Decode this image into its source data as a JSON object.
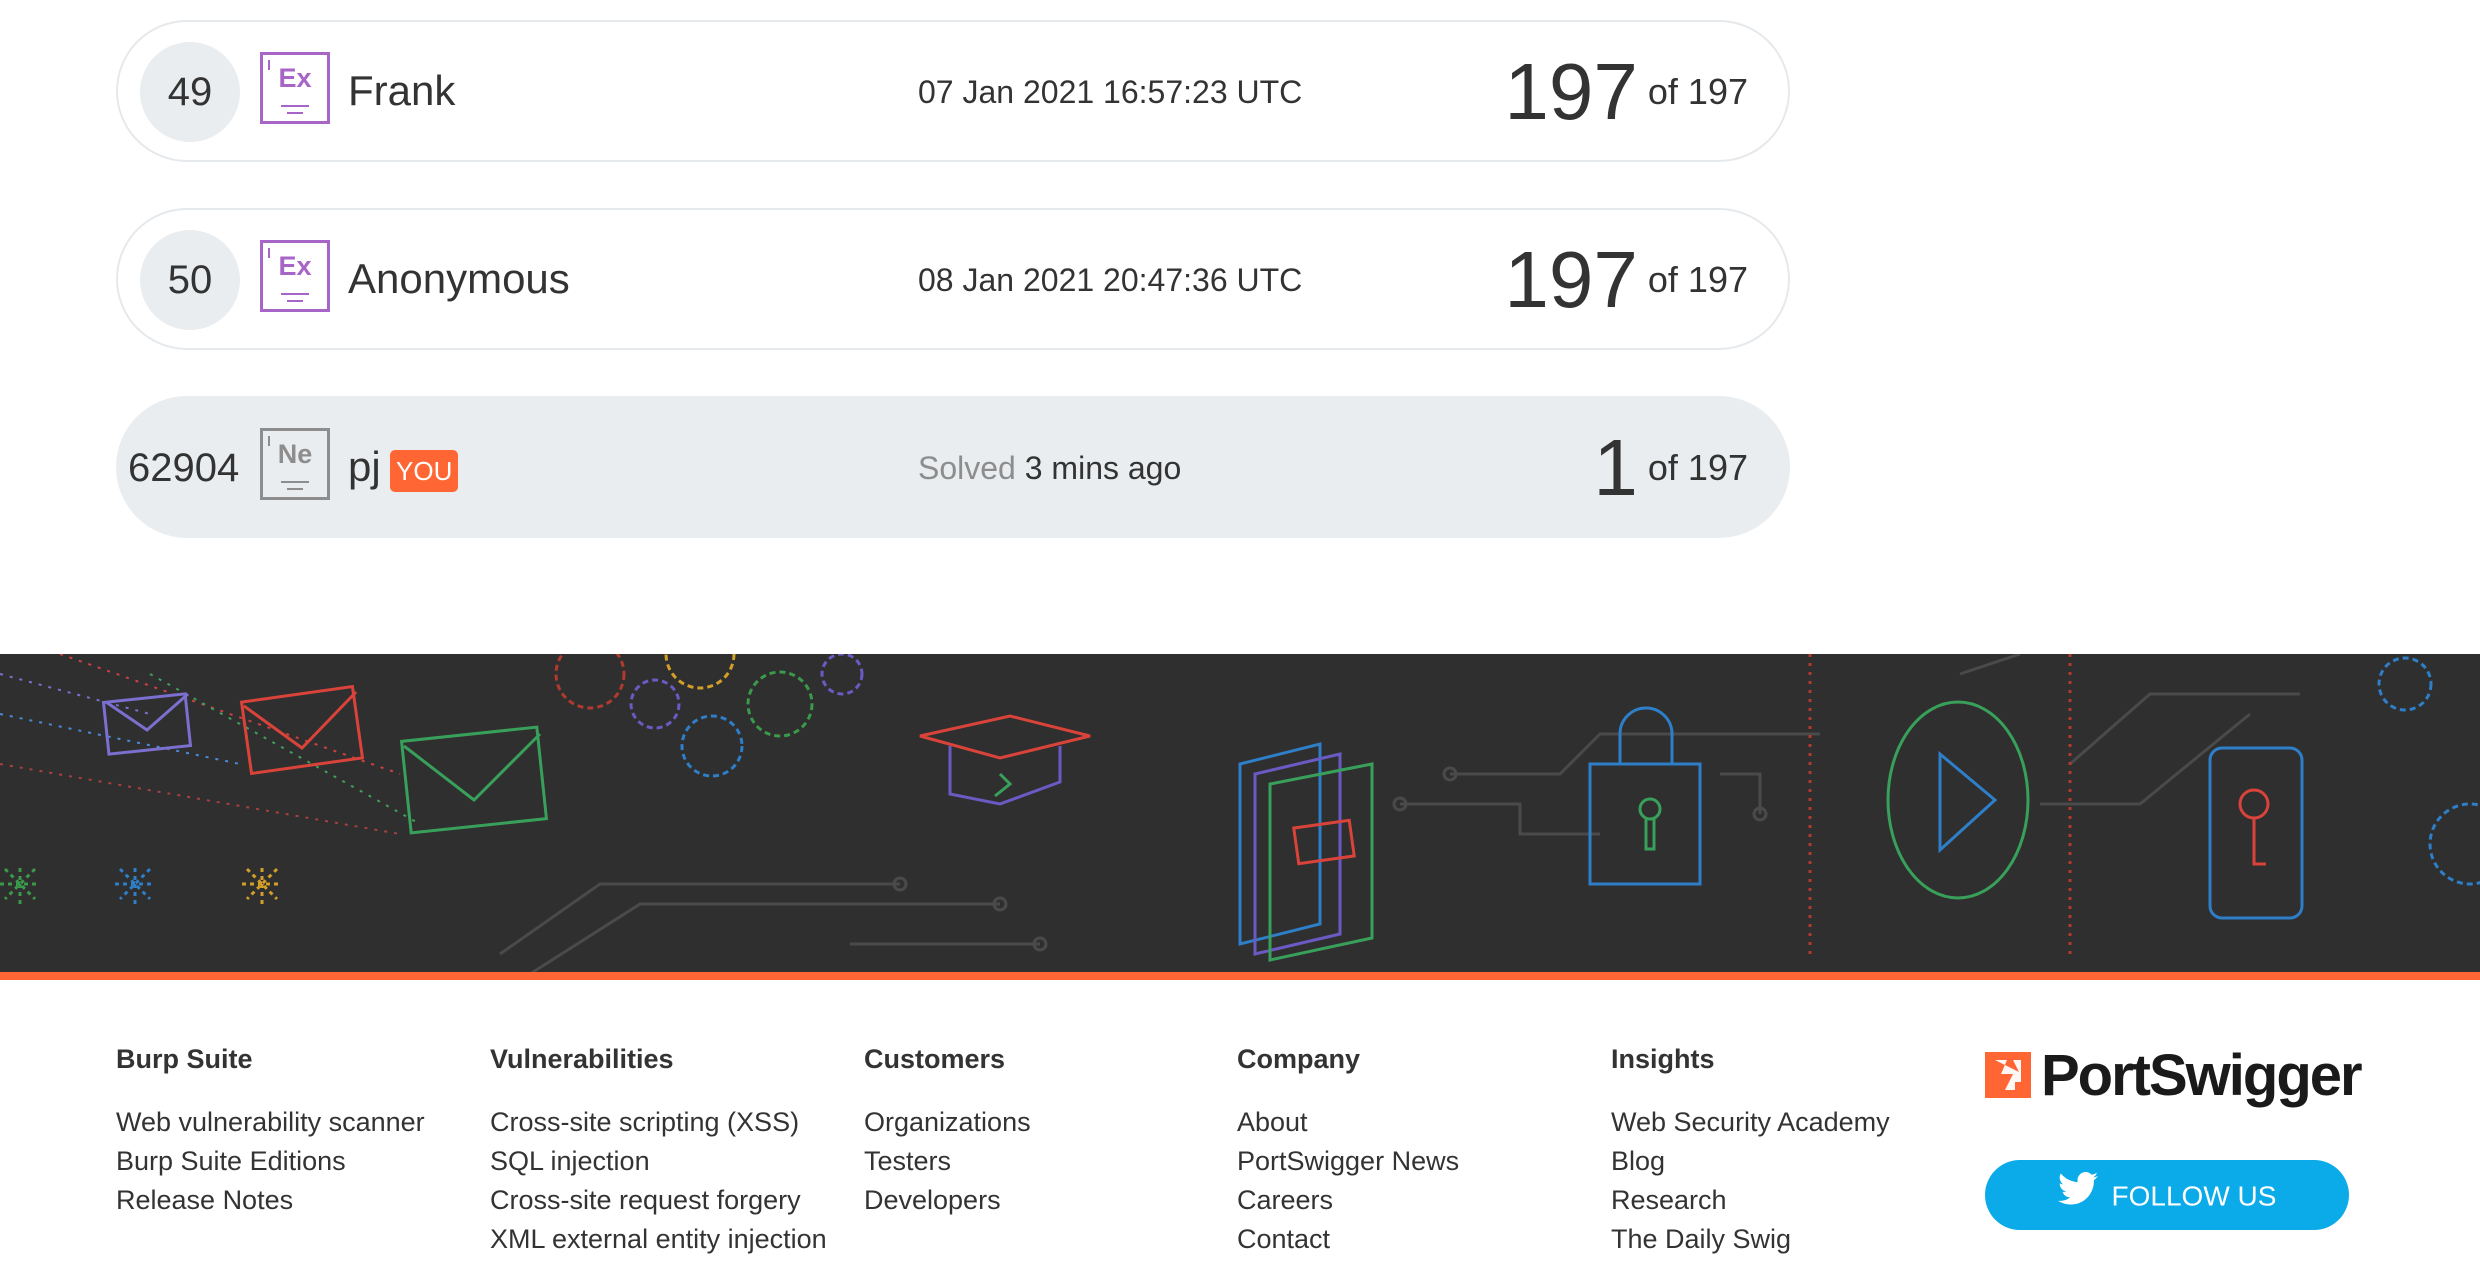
{
  "leaderboard": {
    "rows": [
      {
        "rank": "49",
        "badge": "Ex",
        "name": "Frank",
        "time": "07 Jan 2021 16:57:23 UTC",
        "score": "197",
        "of": "of 197"
      },
      {
        "rank": "50",
        "badge": "Ex",
        "name": "Anonymous",
        "time": "08 Jan 2021 20:47:36 UTC",
        "score": "197",
        "of": "of 197"
      }
    ],
    "you": {
      "rank": "62904",
      "badge": "Ne",
      "name": "pj",
      "tag": "YOU",
      "solved_label": "Solved",
      "solved_time": "3 mins ago",
      "score": "1",
      "of": "of 197"
    }
  },
  "colors": {
    "accent": "#ff6633",
    "expert_badge": "#a865c8",
    "novice_badge": "#8d8d8d",
    "banner_bg": "#2f2f2f",
    "twitter": "#0aabe8"
  },
  "footer": {
    "columns": [
      {
        "title": "Burp Suite",
        "links": [
          "Web vulnerability scanner",
          "Burp Suite Editions",
          "Release Notes"
        ]
      },
      {
        "title": "Vulnerabilities",
        "links": [
          "Cross-site scripting (XSS)",
          "SQL injection",
          "Cross-site request forgery",
          "XML external entity injection"
        ]
      },
      {
        "title": "Customers",
        "links": [
          "Organizations",
          "Testers",
          "Developers"
        ]
      },
      {
        "title": "Company",
        "links": [
          "About",
          "PortSwigger News",
          "Careers",
          "Contact"
        ]
      },
      {
        "title": "Insights",
        "links": [
          "Web Security Academy",
          "Blog",
          "Research",
          "The Daily Swig"
        ]
      }
    ],
    "logo_text": "PortSwigger",
    "follow_label": "FOLLOW US"
  }
}
